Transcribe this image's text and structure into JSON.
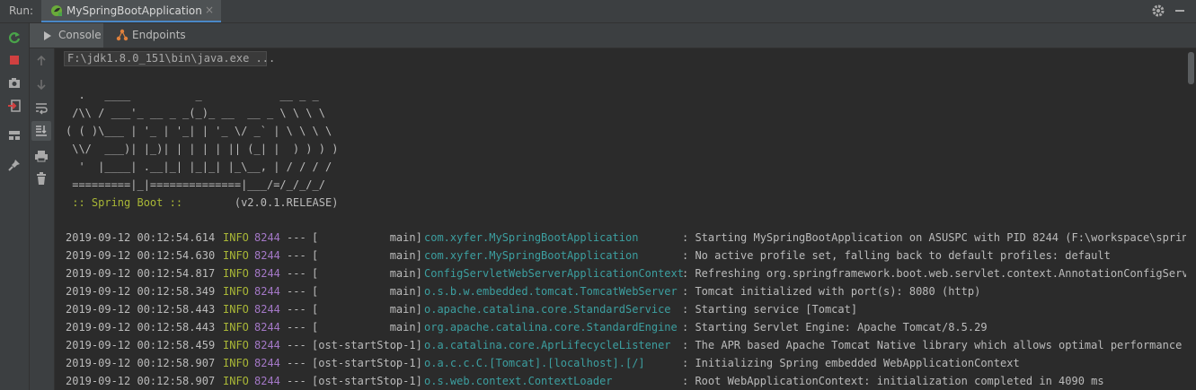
{
  "run_panel": {
    "label": "Run:",
    "tab_label": "MySpringBootApplication",
    "close_glyph": "×"
  },
  "toolbar_icons": {
    "left": [
      "rerun-icon",
      "stop-icon",
      "camera-icon",
      "exit-icon",
      "layout-icon",
      "pin-icon"
    ],
    "console": [
      "arrow-up-icon",
      "arrow-down-icon",
      "soft-wrap-icon",
      "scroll-to-end-icon",
      "print-icon",
      "trash-icon"
    ]
  },
  "subtabs": [
    {
      "label": "Console",
      "icon": "console-icon"
    },
    {
      "label": "Endpoints",
      "icon": "endpoints-icon"
    }
  ],
  "console": {
    "command": "F:\\jdk1.8.0_151\\bin\\java.exe ...",
    "banner": "  .   ____          _            __ _ _\n /\\\\ / ___'_ __ _ _(_)_ __  __ _ \\ \\ \\ \\\n( ( )\\___ | '_ | '_| | '_ \\/ _` | \\ \\ \\ \\\n \\\\/  ___)| |_)| | | | | || (_| |  ) ) ) )\n  '  |____| .__|_| |_|_| |_\\__, | / / / /\n =========|_|==============|___/=/_/_/_/",
    "spring_boot_label": " :: Spring Boot :: ",
    "spring_boot_version": "       (v2.0.1.RELEASE)",
    "logs": [
      {
        "ts": "2019-09-12 00:12:54.614",
        "level": "INFO",
        "pid": "8244",
        "sep": "---",
        "thread": "[           main]",
        "logger": "com.xyfer.MySpringBootApplication",
        "msg": ": Starting MySpringBootApplication on ASUSPC with PID 8244 (F:\\workspace\\springboo"
      },
      {
        "ts": "2019-09-12 00:12:54.630",
        "level": "INFO",
        "pid": "8244",
        "sep": "---",
        "thread": "[           main]",
        "logger": "com.xyfer.MySpringBootApplication",
        "msg": ": No active profile set, falling back to default profiles: default"
      },
      {
        "ts": "2019-09-12 00:12:54.817",
        "level": "INFO",
        "pid": "8244",
        "sep": "---",
        "thread": "[           main]",
        "logger": "ConfigServletWebServerApplicationContext",
        "msg": ": Refreshing org.springframework.boot.web.servlet.context.AnnotationConfigServletWe"
      },
      {
        "ts": "2019-09-12 00:12:58.349",
        "level": "INFO",
        "pid": "8244",
        "sep": "---",
        "thread": "[           main]",
        "logger": "o.s.b.w.embedded.tomcat.TomcatWebServer",
        "msg": ": Tomcat initialized with port(s): 8080 (http)"
      },
      {
        "ts": "2019-09-12 00:12:58.443",
        "level": "INFO",
        "pid": "8244",
        "sep": "---",
        "thread": "[           main]",
        "logger": "o.apache.catalina.core.StandardService",
        "msg": ": Starting service [Tomcat]"
      },
      {
        "ts": "2019-09-12 00:12:58.443",
        "level": "INFO",
        "pid": "8244",
        "sep": "---",
        "thread": "[           main]",
        "logger": "org.apache.catalina.core.StandardEngine",
        "msg": ": Starting Servlet Engine: Apache Tomcat/8.5.29"
      },
      {
        "ts": "2019-09-12 00:12:58.459",
        "level": "INFO",
        "pid": "8244",
        "sep": "---",
        "thread": "[ost-startStop-1]",
        "logger": "o.a.catalina.core.AprLifecycleListener",
        "msg": ": The APR based Apache Tomcat Native library which allows optimal performance in"
      },
      {
        "ts": "2019-09-12 00:12:58.907",
        "level": "INFO",
        "pid": "8244",
        "sep": "---",
        "thread": "[ost-startStop-1]",
        "logger": "o.a.c.c.C.[Tomcat].[localhost].[/]",
        "msg": ": Initializing Spring embedded WebApplicationContext"
      },
      {
        "ts": "2019-09-12 00:12:58.907",
        "level": "INFO",
        "pid": "8244",
        "sep": "---",
        "thread": "[ost-startStop-1]",
        "logger": "o.s.web.context.ContextLoader",
        "msg": ": Root WebApplicationContext: initialization completed in 4090 ms"
      }
    ]
  },
  "colors": {
    "background": "#2b2b2b",
    "panel": "#3c3f41",
    "info": "#a9b736",
    "pid": "#a478c7",
    "logger": "#3c9fa0",
    "text": "#bbbbbb",
    "rerun": "#4aa34a",
    "stop": "#d04040"
  }
}
